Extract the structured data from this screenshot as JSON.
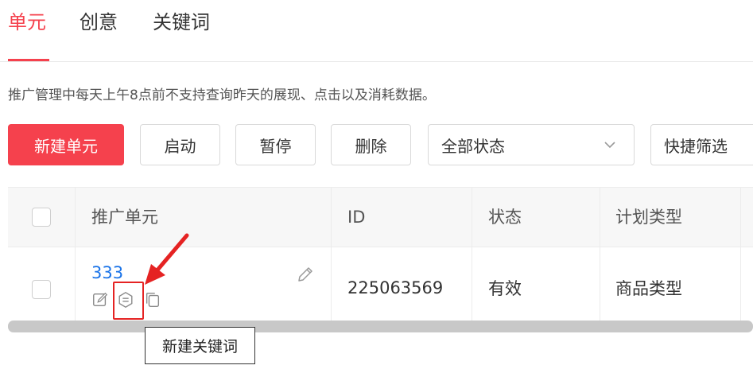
{
  "tabs": [
    {
      "label": "单元",
      "active": true
    },
    {
      "label": "创意",
      "active": false
    },
    {
      "label": "关键词",
      "active": false
    }
  ],
  "notice": "推广管理中每天上午8点前不支持查询昨天的展现、点击以及消耗数据。",
  "toolbar": {
    "new_unit": "新建单元",
    "start": "启动",
    "pause": "暂停",
    "delete": "删除",
    "status_select": "全部状态",
    "quick_filter": "快捷筛选"
  },
  "table": {
    "headers": [
      "推广单元",
      "ID",
      "状态",
      "计划类型"
    ],
    "rows": [
      {
        "unit": "333",
        "id": "225063569",
        "status": "有效",
        "plan_type": "商品类型"
      }
    ]
  },
  "tooltip": "新建关键词",
  "colors": {
    "accent": "#f5414d",
    "link": "#1a73e8",
    "annotation": "#e52323"
  }
}
